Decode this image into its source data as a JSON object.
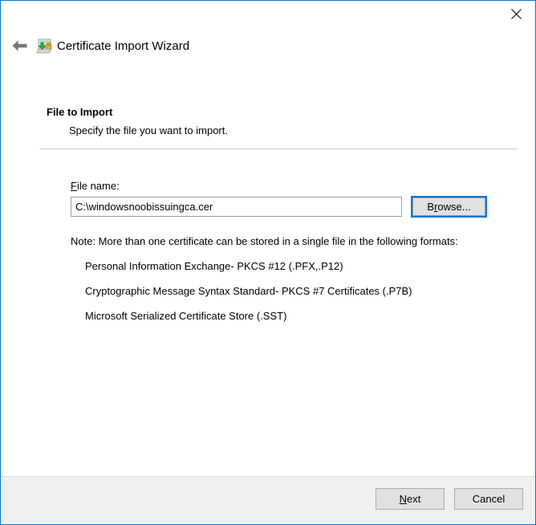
{
  "window": {
    "title": "Certificate Import Wizard",
    "border_color": "#0078d7",
    "app_icon": "certificate-import-icon",
    "back_icon": "back-arrow-icon",
    "close_icon": "close-icon"
  },
  "page": {
    "heading": "File to Import",
    "subheading": "Specify the file you want to import."
  },
  "file_field": {
    "label_prefix": "F",
    "label_rest": "ile name:",
    "value": "C:\\windowsnoobissuingca.cer",
    "browse_prefix": "B",
    "browse_accel": "r",
    "browse_rest": "owse..."
  },
  "note": {
    "text": "Note:  More than one certificate can be stored in a single file in the following formats:",
    "formats": [
      "Personal Information Exchange- PKCS #12 (.PFX,.P12)",
      "Cryptographic Message Syntax Standard- PKCS #7 Certificates (.P7B)",
      "Microsoft Serialized Certificate Store (.SST)"
    ]
  },
  "footer": {
    "next_accel": "N",
    "next_rest": "ext",
    "cancel_label": "Cancel"
  }
}
